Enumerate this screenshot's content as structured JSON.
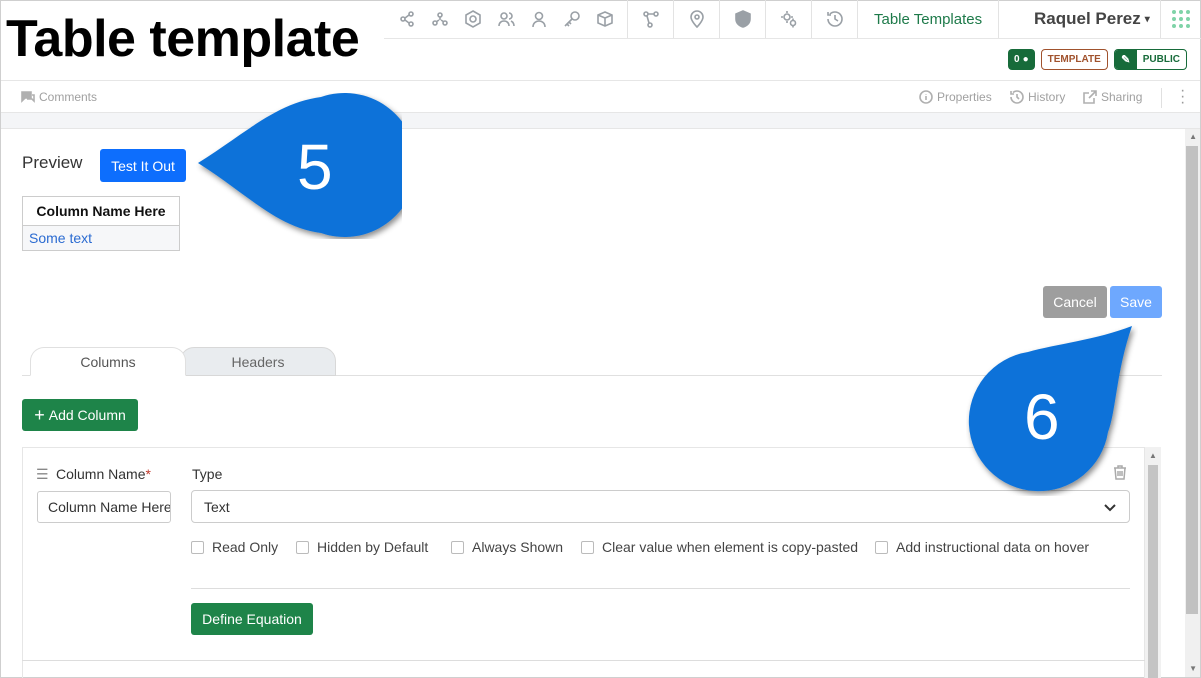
{
  "page_title": "Table template",
  "toolbar": {
    "icons": [
      "share-icon",
      "network-icon",
      "cube-badge-icon",
      "users-icon",
      "user-icon",
      "key-icon",
      "box-icon",
      "workflow-icon",
      "location-pin-icon",
      "shield-icon",
      "gears-icon",
      "history-clock-icon"
    ],
    "link": "Table Templates"
  },
  "user": {
    "name": "Raquel Perez"
  },
  "badges": {
    "comments_count": "0",
    "template": "TEMPLATE",
    "public": "PUBLIC"
  },
  "subbar": {
    "comments": "Comments",
    "properties": "Properties",
    "history": "History",
    "sharing": "Sharing"
  },
  "preview": {
    "label": "Preview",
    "test_button": "Test It Out",
    "table": {
      "header": "Column Name Here",
      "cell": "Some text"
    }
  },
  "actions": {
    "cancel": "Cancel",
    "save": "Save"
  },
  "tabs": [
    {
      "label": "Columns",
      "active": true
    },
    {
      "label": "Headers",
      "active": false
    }
  ],
  "add_column_button": "Add Column",
  "column": {
    "name_label": "Column Name",
    "required_marker": "*",
    "name_value": "Column Name Here",
    "type_label": "Type",
    "type_value": "Text",
    "options": [
      {
        "label": "Read Only",
        "checked": false
      },
      {
        "label": "Hidden by Default",
        "checked": false
      },
      {
        "label": "Always Shown",
        "checked": false
      },
      {
        "label": "Clear value when element is copy-pasted",
        "checked": false
      },
      {
        "label": "Add instructional data on hover",
        "checked": false
      }
    ],
    "define_equation_button": "Define Equation"
  },
  "callouts": [
    {
      "number": "5"
    },
    {
      "number": "6"
    }
  ],
  "colors": {
    "primary": "#0d6efd",
    "success": "#1e8449",
    "callout": "#0b72d9",
    "template_badge": "#a0522d"
  }
}
